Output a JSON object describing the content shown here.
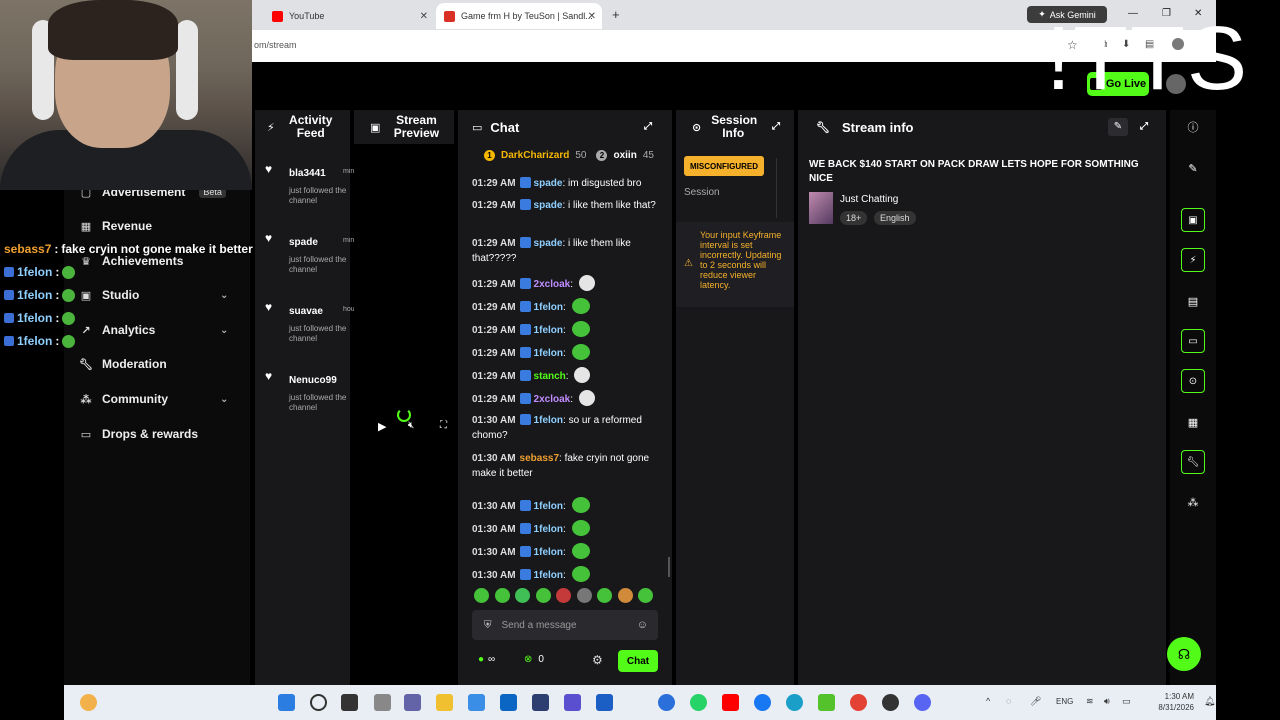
{
  "browser": {
    "tabs": [
      {
        "label": "YouTube",
        "color": "#ff0000"
      },
      {
        "label": "Game frm H by TeuSon | Sandl...",
        "color": "#d93025"
      }
    ],
    "url": "om/stream",
    "ask_label": "Ask Gemini"
  },
  "overlay": {
    "tts_text": "!TTS",
    "chat": [
      {
        "user": "sebass7",
        "text": "fake cryin not gone make it better"
      },
      {
        "user": "1felon",
        "text": ":"
      },
      {
        "user": "1felon",
        "text": ":"
      },
      {
        "user": "1felon",
        "text": ":"
      },
      {
        "user": "1felon",
        "text": ":"
      }
    ]
  },
  "topbar": {
    "go_live": "Go Live"
  },
  "leftnav": {
    "items": [
      {
        "label": "Advertisement",
        "badge": "Beta",
        "icon": "ad-icon"
      },
      {
        "label": "Revenue",
        "icon": "revenue-icon"
      },
      {
        "label": "Achievements",
        "icon": "trophy-icon"
      },
      {
        "label": "Studio",
        "icon": "studio-icon",
        "chevron": true
      },
      {
        "label": "Analytics",
        "icon": "analytics-icon",
        "chevron": true
      },
      {
        "label": "Moderation",
        "icon": "wrench-icon"
      },
      {
        "label": "Community",
        "icon": "community-icon",
        "chevron": true
      },
      {
        "label": "Drops & rewards",
        "icon": "gift-icon"
      }
    ]
  },
  "activity": {
    "title": "Activity Feed",
    "items": [
      {
        "name": "bla3441",
        "ago": "min",
        "desc": "just followed the channel"
      },
      {
        "name": "spade",
        "ago": "minut",
        "desc": "just followed the channel"
      },
      {
        "name": "suavae",
        "ago": "hour ago",
        "desc": "just followed the channel"
      },
      {
        "name": "Nenuco99",
        "ago": "",
        "desc": "just followed the channel"
      }
    ]
  },
  "preview": {
    "title": "Stream Preview"
  },
  "chat": {
    "title": "Chat",
    "top_gifters": [
      {
        "rank": "1",
        "name": "DarkCharizard",
        "count": "50",
        "color": "#f5b800"
      },
      {
        "rank": "2",
        "name": "oxiin",
        "count": "45",
        "color": "#aaaaaa"
      }
    ],
    "messages": [
      {
        "time": "01:29 AM",
        "user": "spade",
        "color": "#8fd0ff",
        "text": "im disgusted bro",
        "kind": "text"
      },
      {
        "time": "01:29 AM",
        "user": "spade",
        "color": "#8fd0ff",
        "text": "i like them like that?",
        "kind": "text"
      },
      {
        "time": "01:29 AM",
        "user": "spade",
        "color": "#8fd0ff",
        "text": "i like them like that?????",
        "kind": "text"
      },
      {
        "time": "01:29 AM",
        "user": "2xcloak",
        "color": "#c08cff",
        "text": "",
        "kind": "skull"
      },
      {
        "time": "01:29 AM",
        "user": "1felon",
        "color": "#8fd0ff",
        "text": "",
        "kind": "emote"
      },
      {
        "time": "01:29 AM",
        "user": "1felon",
        "color": "#8fd0ff",
        "text": "",
        "kind": "emote"
      },
      {
        "time": "01:29 AM",
        "user": "1felon",
        "color": "#8fd0ff",
        "text": "",
        "kind": "emote"
      },
      {
        "time": "01:29 AM",
        "user": "stanch",
        "color": "#53fc18",
        "text": "",
        "kind": "skull"
      },
      {
        "time": "01:29 AM",
        "user": "2xcloak",
        "color": "#c08cff",
        "text": "",
        "kind": "skull"
      },
      {
        "time": "01:30 AM",
        "user": "1felon",
        "color": "#8fd0ff",
        "text": "so ur a reformed chomo?",
        "kind": "text"
      },
      {
        "time": "01:30 AM",
        "user": "sebass7",
        "color": "#f0a030",
        "text": "fake cryin not gone make it better",
        "kind": "text"
      },
      {
        "time": "01:30 AM",
        "user": "1felon",
        "color": "#8fd0ff",
        "text": "",
        "kind": "emote"
      },
      {
        "time": "01:30 AM",
        "user": "1felon",
        "color": "#8fd0ff",
        "text": "",
        "kind": "emote"
      },
      {
        "time": "01:30 AM",
        "user": "1felon",
        "color": "#8fd0ff",
        "text": "",
        "kind": "emote"
      },
      {
        "time": "01:30 AM",
        "user": "1felon",
        "color": "#8fd0ff",
        "text": "",
        "kind": "emote"
      }
    ],
    "input_placeholder": "Send a message",
    "viewer_count": "∞",
    "points": "0",
    "send_label": "Chat"
  },
  "session": {
    "title": "Session Info",
    "badge": "MISCONFIGURED",
    "label": "Session",
    "warning": "Your input Keyframe interval is set incorrectly. Updating to 2 seconds will reduce viewer latency."
  },
  "stream_info": {
    "title": "Stream info",
    "stream_title": "WE BACK $140 START ON PACK DRAW LETS HOPE FOR SOMTHING NICE",
    "category": "Just Chatting",
    "tags": [
      "18+",
      "English"
    ]
  },
  "taskbar": {
    "lang": "ENG",
    "time": "1:30 AM",
    "date": "8/31/2026"
  }
}
